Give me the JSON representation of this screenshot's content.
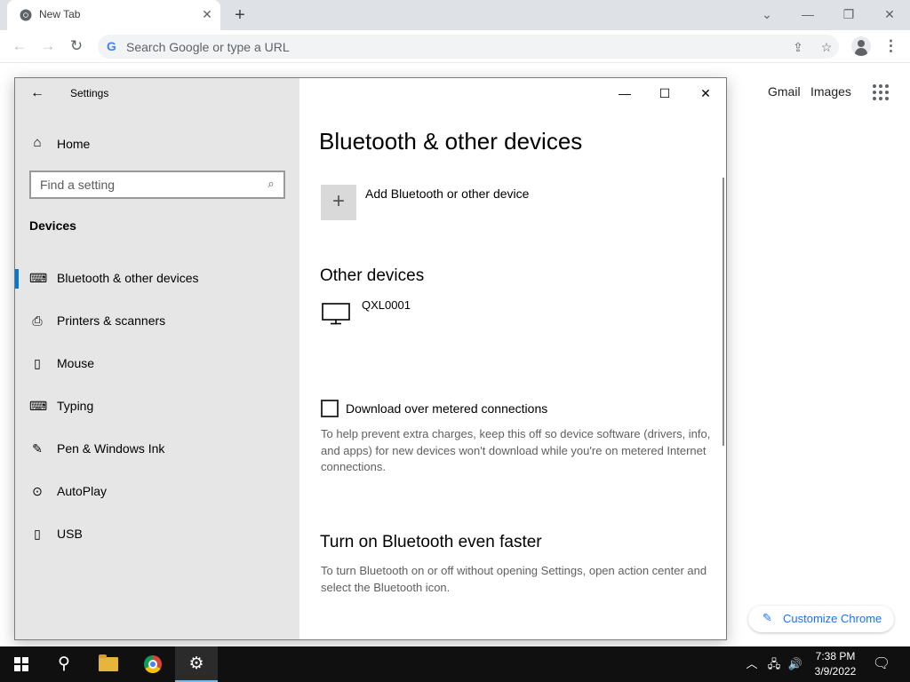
{
  "browser": {
    "tab_title": "New Tab",
    "tab_close": "✕",
    "new_tab": "+",
    "window_controls": {
      "dropdown": "⌄",
      "minimize": "—",
      "restore": "❐",
      "close": "✕"
    },
    "omnibox": {
      "g_icon": "G",
      "placeholder": "Search Google or type a URL"
    },
    "nav": {
      "back": "←",
      "forward": "→",
      "reload": "↻"
    },
    "share_icon": "⇪",
    "star_icon": "☆",
    "menu_icon": "⋮",
    "ntp": {
      "gmail": "Gmail",
      "images": "Images",
      "customize_label": "Customize Chrome",
      "customize_icon": "✎"
    }
  },
  "settings": {
    "title": "Settings",
    "back_icon": "←",
    "window_controls": {
      "minimize": "—",
      "maximize": "☐",
      "close": "✕"
    },
    "sidebar": {
      "home_icon": "⌂",
      "home_label": "Home",
      "search_placeholder": "Find a setting",
      "search_icon": "⌕",
      "section": "Devices",
      "items": [
        {
          "label": "Bluetooth & other devices",
          "icon": "bluetooth-devices-icon",
          "glyph": "⌨",
          "selected": true
        },
        {
          "label": "Printers & scanners",
          "icon": "printer-icon",
          "glyph": "⎙",
          "selected": false
        },
        {
          "label": "Mouse",
          "icon": "mouse-icon",
          "glyph": "▯",
          "selected": false
        },
        {
          "label": "Typing",
          "icon": "keyboard-icon",
          "glyph": "⌨",
          "selected": false
        },
        {
          "label": "Pen & Windows Ink",
          "icon": "pen-icon",
          "glyph": "✎",
          "selected": false
        },
        {
          "label": "AutoPlay",
          "icon": "autoplay-icon",
          "glyph": "⊙",
          "selected": false
        },
        {
          "label": "USB",
          "icon": "usb-icon",
          "glyph": "▯",
          "selected": false
        }
      ]
    },
    "content": {
      "page_title": "Bluetooth & other devices",
      "add_icon": "+",
      "add_device_label": "Add Bluetooth or other device",
      "other_devices_heading": "Other devices",
      "device_name": "QXL0001",
      "metered_label": "Download over metered connections",
      "metered_checked": false,
      "metered_desc": "To help prevent extra charges, keep this off so device software (drivers, info, and apps) for new devices won't download while you're on metered Internet connections.",
      "faster_heading": "Turn on Bluetooth even faster",
      "faster_desc": "To turn Bluetooth on or off without opening Settings, open action center and select the Bluetooth icon."
    }
  },
  "taskbar": {
    "search_glyph": "⚲",
    "settings_glyph": "⚙",
    "tray_chevron": "︿",
    "network_glyph": "🖧",
    "volume_glyph": "🔊",
    "notifications_glyph": "🗨",
    "time": "7:38 PM",
    "date": "3/9/2022"
  },
  "colors": {
    "accent": "#0078d7",
    "chrome_link": "#1a73e8",
    "sidebar_bg": "#e6e6e6",
    "taskbar_bg": "#101010"
  }
}
